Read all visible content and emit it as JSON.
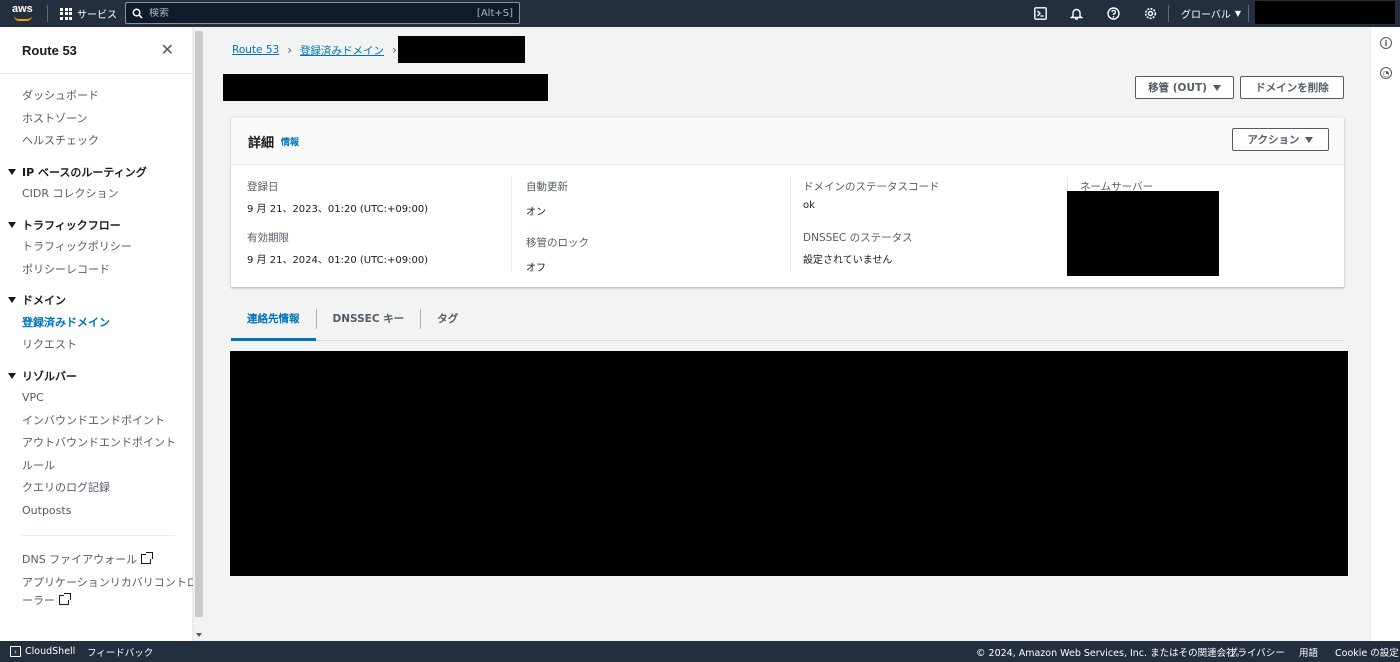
{
  "topnav": {
    "logo_text": "aws",
    "services_label": "サービス",
    "search_placeholder": "検索",
    "search_shortcut": "[Alt+S]",
    "region_label": "グローバル"
  },
  "sidebar": {
    "title": "Route 53",
    "items_top": [
      "ダッシュボード",
      "ホストゾーン",
      "ヘルスチェック"
    ],
    "sections": [
      {
        "label": "IP ベースのルーティング",
        "items": [
          "CIDR コレクション"
        ]
      },
      {
        "label": "トラフィックフロー",
        "items": [
          "トラフィックポリシー",
          "ポリシーレコード"
        ]
      },
      {
        "label": "ドメイン",
        "items": [
          "登録済みドメイン",
          "リクエスト"
        ]
      },
      {
        "label": "リゾルバー",
        "items": [
          "VPC",
          "インバウンドエンドポイント",
          "アウトバウンドエンドポイント",
          "ルール",
          "クエリのログ記録",
          "Outposts"
        ]
      }
    ],
    "active_item": "登録済みドメイン",
    "bottom_links": [
      "DNS ファイアウォール",
      "アプリケーションリカバリコントロ",
      "ーラー"
    ]
  },
  "breadcrumb": {
    "root": "Route 53",
    "parent": "登録済みドメイン"
  },
  "header_buttons": {
    "transfer_out": "移管 (OUT)",
    "delete_domain": "ドメインを削除"
  },
  "details": {
    "title": "詳細",
    "info_link": "情報",
    "actions_label": "アクション",
    "registered_label": "登録日",
    "registered_value": "9 月 21、2023、01:20 (UTC:+09:00)",
    "expires_label": "有効期限",
    "expires_value": "9 月 21、2024、01:20 (UTC:+09:00)",
    "autorenew_label": "自動更新",
    "autorenew_value": "オン",
    "transferlock_label": "移管のロック",
    "transferlock_value": "オフ",
    "statuscode_label": "ドメインのステータスコード",
    "statuscode_value": "ok",
    "dnssec_label": "DNSSEC のステータス",
    "dnssec_value": "設定されていません",
    "nameservers_label": "ネームサーバー"
  },
  "tabs": [
    "連絡先情報",
    "DNSSEC キー",
    "タグ"
  ],
  "footer": {
    "cloudshell": "CloudShell",
    "feedback": "フィードバック",
    "copyright": "© 2024, Amazon Web Services, Inc. またはその関連会社。",
    "privacy": "プライバシー",
    "terms": "用語",
    "cookies": "Cookie の設定"
  },
  "colors": {
    "nav_bg": "#232f3e",
    "accent": "#0073bb",
    "aws_orange": "#ff9900"
  }
}
